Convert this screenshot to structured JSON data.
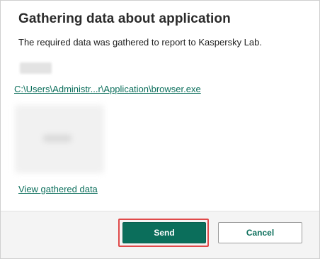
{
  "dialog": {
    "title": "Gathering data about application",
    "description": "The required data was gathered to report to Kaspersky Lab.",
    "file_path_link": "C:\\Users\\Administr...r\\Application\\browser.exe",
    "view_data_link": "View gathered data"
  },
  "buttons": {
    "send_label": "Send",
    "cancel_label": "Cancel"
  },
  "colors": {
    "accent": "#0b6e5b",
    "highlight": "#e04a4a"
  }
}
